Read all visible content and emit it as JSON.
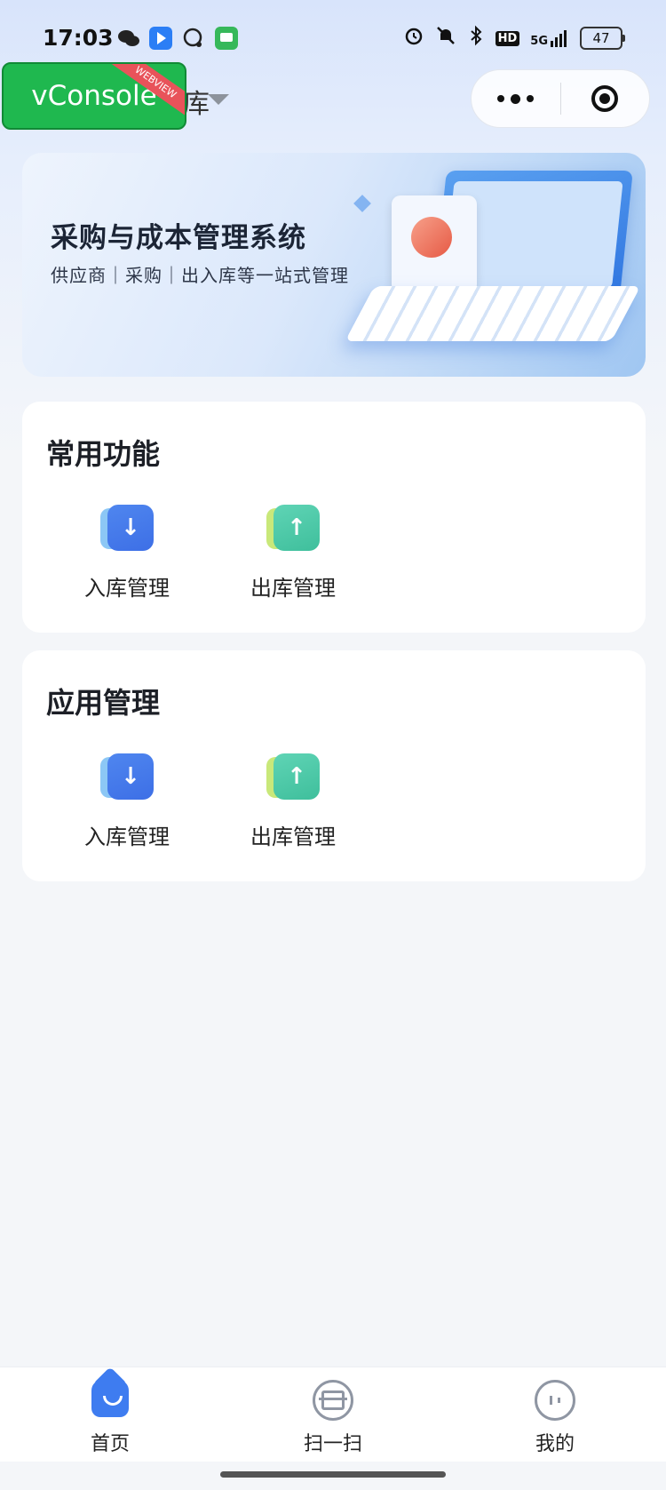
{
  "status_bar": {
    "time": "17:03",
    "battery": "47",
    "network": "5G",
    "hd": "HD",
    "app_icons": [
      "wechat-icon",
      "blue-app-icon",
      "chat-bubble-icon",
      "green-message-icon"
    ],
    "right_icons": [
      "alarm-icon",
      "mute-bell-icon",
      "bluetooth-icon",
      "hd-icon",
      "signal-icon",
      "battery-icon"
    ]
  },
  "header": {
    "vconsole_label": "vConsole",
    "vconsole_ribbon": "WEBVIEW",
    "title_fragment": "库"
  },
  "banner": {
    "title": "采购与成本管理系统",
    "subtitle": "供应商｜采购｜出入库等一站式管理"
  },
  "common_functions": {
    "title": "常用功能",
    "items": [
      {
        "label": "入库管理",
        "icon": "arrow-down-icon",
        "glyph": "↓"
      },
      {
        "label": "出库管理",
        "icon": "arrow-up-icon",
        "glyph": "↑"
      }
    ]
  },
  "app_management": {
    "title": "应用管理",
    "items": [
      {
        "label": "入库管理",
        "icon": "arrow-down-icon",
        "glyph": "↓"
      },
      {
        "label": "出库管理",
        "icon": "arrow-up-icon",
        "glyph": "↑"
      }
    ]
  },
  "tabbar": {
    "items": [
      {
        "label": "首页",
        "icon": "home-icon",
        "active": true
      },
      {
        "label": "扫一扫",
        "icon": "scan-icon",
        "active": false
      },
      {
        "label": "我的",
        "icon": "profile-icon",
        "active": false
      }
    ]
  },
  "colors": {
    "accent": "#3e7cf0",
    "inbound": "#4f86ef",
    "outbound": "#3fbf9c",
    "vconsole": "#1fb84f"
  }
}
